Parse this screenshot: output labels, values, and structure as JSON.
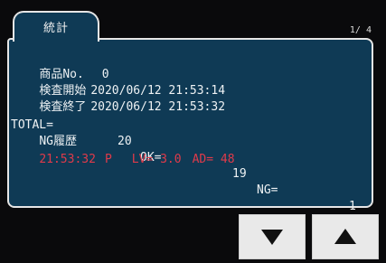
{
  "tab": {
    "label": "統計"
  },
  "page": {
    "indicator": "1/ 4"
  },
  "info": {
    "product_label": "商品No.",
    "product_value": "0",
    "start_label": "検査開始",
    "start_value": "2020/06/12 21:53:14",
    "end_label": "検査終了",
    "end_value": "2020/06/12 21:53:32"
  },
  "totals": {
    "total_label": "TOTAL=",
    "total_value": "20",
    "ok_label": "OK=",
    "ok_value": "19",
    "ng_label": "NG=",
    "ng_value": "1"
  },
  "ng_history": {
    "label": "NG履歴",
    "entries": [
      {
        "time": "21:53:32",
        "flag": "P",
        "lv": "LV= 3.0",
        "ad": "AD= 48"
      }
    ]
  },
  "colors": {
    "panel_bg": "#0f3a55",
    "text": "#eef2f4",
    "alert": "#e03a4a",
    "button_bg": "#e9e9e9"
  },
  "buttons": {
    "down_icon": "down-triangle-icon",
    "up_icon": "up-triangle-icon"
  }
}
